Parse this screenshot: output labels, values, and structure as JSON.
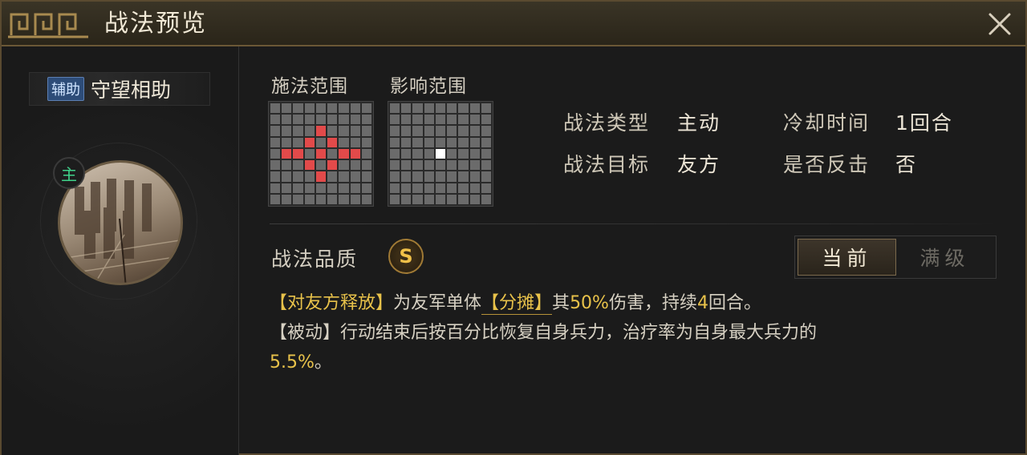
{
  "window": {
    "title": "战法预览",
    "accent": "#6b5836"
  },
  "skill": {
    "tag": "辅助",
    "name": "守望相助",
    "badge": "主"
  },
  "ranges": {
    "cast_label": "施法范围",
    "effect_label": "影响范围",
    "cast_cells_red": [
      [
        4,
        2
      ],
      [
        3,
        3
      ],
      [
        5,
        3
      ],
      [
        2,
        4
      ],
      [
        4,
        4
      ],
      [
        6,
        4
      ],
      [
        3,
        5
      ],
      [
        5,
        5
      ],
      [
        4,
        6
      ],
      [
        1,
        4
      ],
      [
        7,
        4
      ]
    ],
    "effect_cells_white": [
      [
        4,
        4
      ]
    ]
  },
  "info": {
    "type_label": "战法类型",
    "type_value": "主动",
    "cooldown_label": "冷却时间",
    "cooldown_value": "1回合",
    "target_label": "战法目标",
    "target_value": "友方",
    "counter_label": "是否反击",
    "counter_value": "否"
  },
  "quality": {
    "label": "战法品质",
    "grade": "S",
    "color": "#f0c048"
  },
  "toggle": {
    "current": "当前",
    "max": "满级"
  },
  "description": {
    "line1_part1": "【对友方释放】",
    "line1_part2": "为友军单体",
    "line1_part3": "【分摊】",
    "line1_part4": "其",
    "line1_part5": "50%",
    "line1_part6": "伤害，持续",
    "line1_part7": "4",
    "line1_part8": "回合。",
    "line2": "【被动】行动结束后按百分比恢复自身兵力，治疗率为自身最大兵力的",
    "line3": "5.5%",
    "line3_end": "。"
  }
}
